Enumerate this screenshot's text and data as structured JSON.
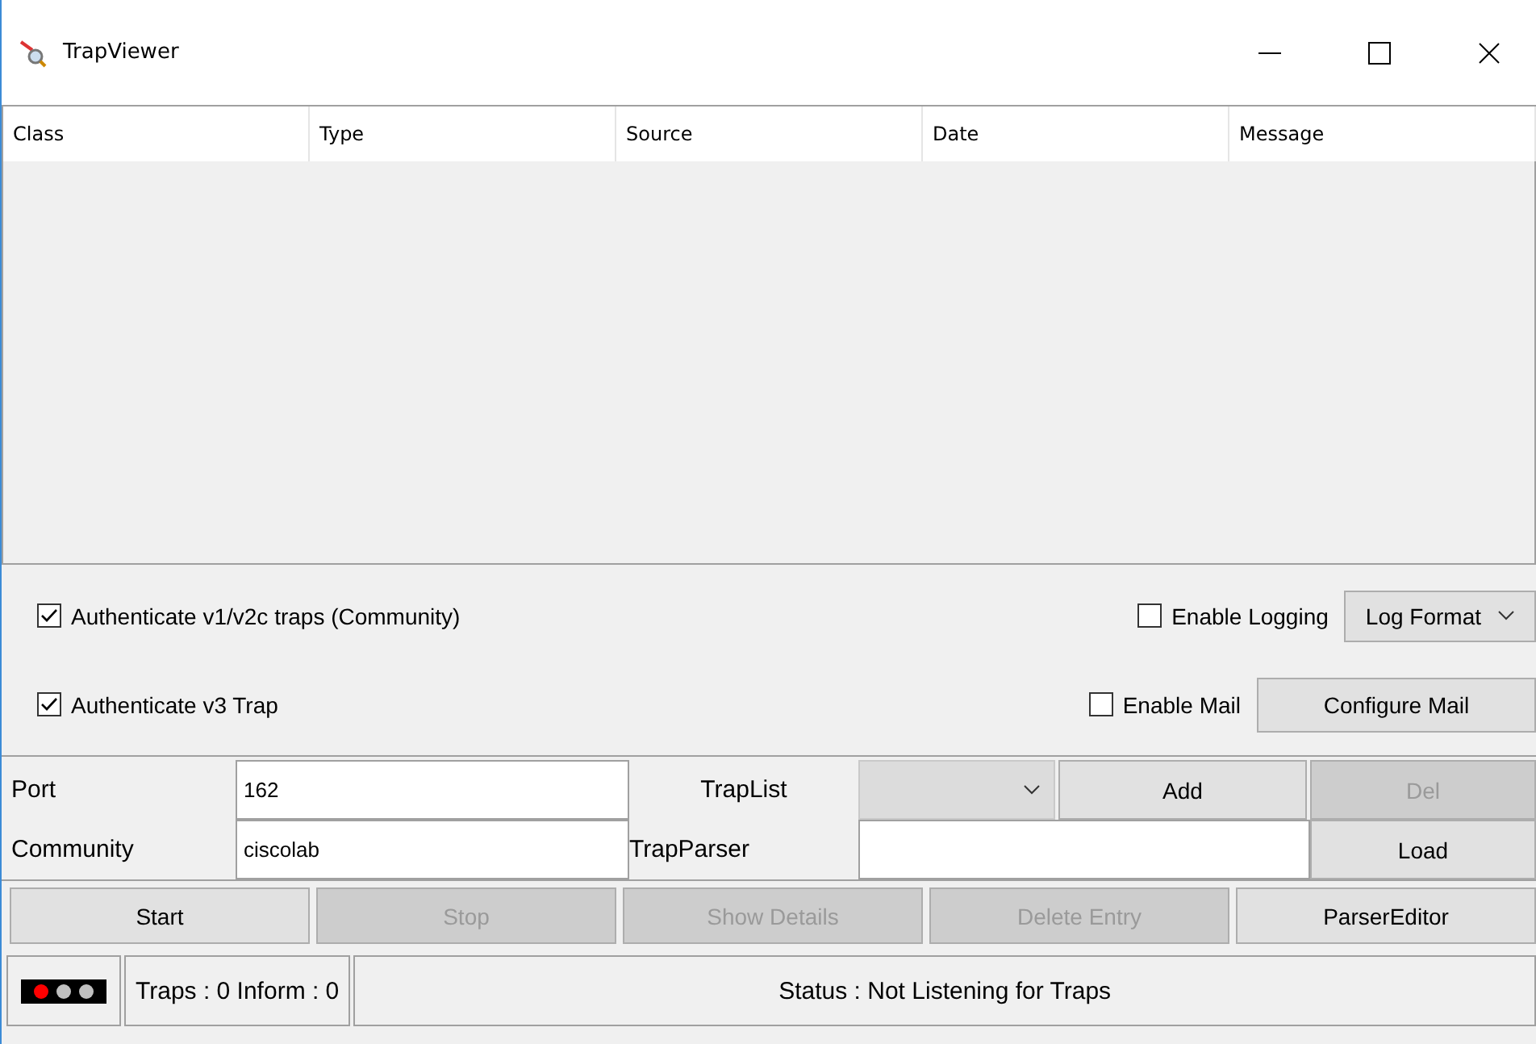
{
  "window": {
    "title": "TrapViewer"
  },
  "table": {
    "columns": [
      "Class",
      "Type",
      "Source",
      "Date",
      "Message"
    ]
  },
  "options": [
    {
      "kind": "checkbox",
      "label": "Authenticate v1/v2c traps (Community)",
      "checked": true
    },
    {
      "kind": "checkbox",
      "label": "Enable Logging",
      "checked": false
    },
    {
      "kind": "dropdown",
      "label": "Log Format"
    },
    {
      "kind": "checkbox",
      "label": "Authenticate v3 Trap",
      "checked": true
    },
    {
      "kind": "checkbox",
      "label": "Enable Mail",
      "checked": false
    },
    {
      "kind": "button",
      "label": "Configure Mail"
    }
  ],
  "form": {
    "port_label": "Port",
    "port_value": "162",
    "community_label": "Community",
    "community_value": "ciscolab",
    "traplist_label": "TrapList",
    "add_button": {
      "label": "Add",
      "disabled": false
    },
    "del_button": {
      "label": "Del",
      "disabled": true
    },
    "trapparser_label": "TrapParser",
    "load_button": {
      "label": "Load",
      "disabled": false
    }
  },
  "actions": [
    {
      "label": "Start",
      "disabled": false
    },
    {
      "label": "Stop",
      "disabled": true
    },
    {
      "label": "Show Details",
      "disabled": true
    },
    {
      "label": "Delete Entry",
      "disabled": true
    },
    {
      "label": "ParserEditor",
      "disabled": false
    }
  ],
  "status_bar": {
    "lights": [
      {
        "color": "#ff0000"
      },
      {
        "color": "#c0c0c0"
      },
      {
        "color": "#c0c0c0"
      }
    ],
    "counts": "Traps :  0 Inform :  0",
    "status": "Status : Not Listening for Traps"
  }
}
